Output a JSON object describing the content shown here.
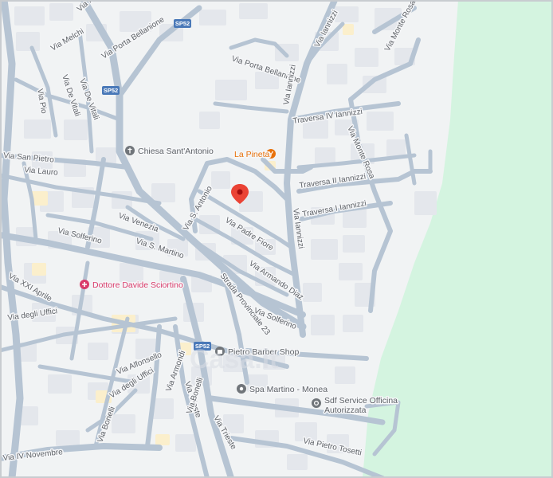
{
  "map": {
    "colors": {
      "land": "#f1f3f4",
      "building": "#e4e7ec",
      "road": "#b6c4d3",
      "road_edge": "#9fb0c2",
      "park": "#d4f4e0",
      "label": "#5f6368",
      "poi_blue": "#1a73e8",
      "poi_orange": "#e8710a",
      "poi_pink": "#d93b6a",
      "poi_gray": "#70757a",
      "pin": "#ea4335",
      "shield": "#4a79b8"
    },
    "street_labels": [
      "Via Melchi",
      "Via Porta Bellanione",
      "Via Porta Bellanione",
      "Via Iannizzi",
      "Via Iannizzi",
      "Via Monte Rosa",
      "Via De Vitali",
      "Via Pio",
      "Via Pio",
      "Traversa IV Iannizzi",
      "Via Monte Rosa",
      "Via San Pietro",
      "Via Lauro",
      "Via Solferino",
      "Via Venezia",
      "Via S. Martino",
      "Via Padre Fiore",
      "Via S. Antonio",
      "Traversa II Iannizzi",
      "Traversa I Iannizzi",
      "Via Armando Diaz",
      "Via Iannizzi",
      "Strada Provinciale 23",
      "Via Solferino",
      "Via XXI Aprile",
      "Via degli Uffici",
      "Via Alfonsello",
      "Via Armondi",
      "Via Trieste",
      "Via Trieste",
      "Via degli Uffici",
      "Via Pietro Tosetti",
      "Via IV Novembre",
      "Via Bonelli",
      "Via Bonelli",
      "Via Pietro Tosetti"
    ],
    "shields": [
      "SP52",
      "SP52",
      "SP52"
    ],
    "pois": [
      {
        "name": "La Pineta",
        "icon": "restaurant-icon"
      },
      {
        "name": "Chiesa Sant'Antonio",
        "icon": "church-icon"
      },
      {
        "name": "Dottore Davide Sciortino",
        "icon": "medical-icon"
      },
      {
        "name": "Pietro Barber Shop",
        "icon": "shop-icon"
      },
      {
        "name": "Spa Martino - Monea",
        "icon": "spa-icon"
      },
      {
        "name": "Sdf Service Officina Autorizzata",
        "icon": "car-repair-icon",
        "line1": "Sdf Service Officina",
        "line2": "Autorizzata"
      }
    ],
    "pin": {
      "icon": "location-pin-icon"
    },
    "watermark": "Casa.it"
  }
}
